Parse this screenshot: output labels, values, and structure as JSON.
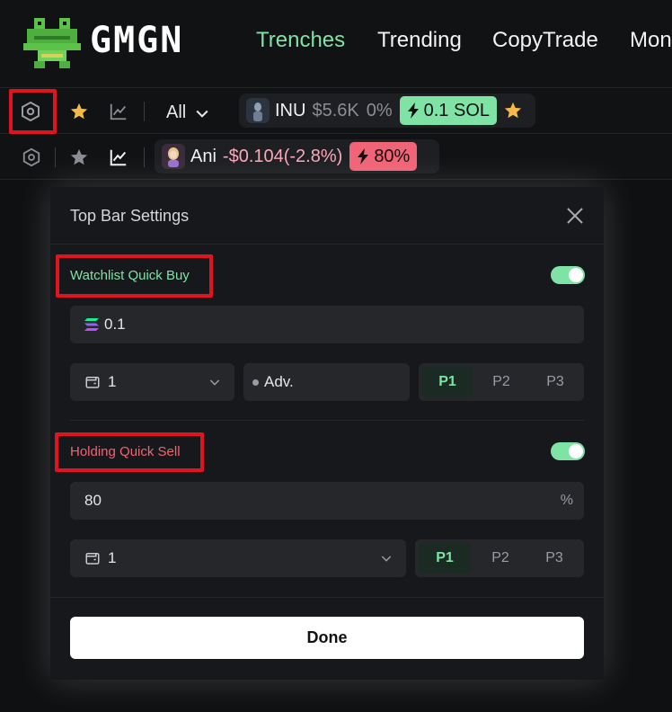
{
  "brand": {
    "name": "GMGN"
  },
  "nav": {
    "links": [
      "Trenches",
      "Trending",
      "CopyTrade",
      "Mon"
    ],
    "active": "Trenches"
  },
  "bar1": {
    "filter": "All",
    "token": {
      "symbol": "INU",
      "mcap": "$5.6K",
      "change": "0%",
      "quick_buy": "0.1 SOL"
    }
  },
  "bar2": {
    "token": {
      "symbol": "Ani",
      "pnl": "-$0.104(-2.8%)",
      "quick_sell": "80%"
    }
  },
  "modal": {
    "title": "Top Bar Settings",
    "buy": {
      "label": "Watchlist Quick Buy",
      "enabled": true,
      "amount": "0.1",
      "wallet": "1",
      "mode": "Adv.",
      "presets": [
        "P1",
        "P2",
        "P3"
      ],
      "active_preset": "P1"
    },
    "sell": {
      "label": "Holding Quick Sell",
      "enabled": true,
      "amount": "80",
      "unit": "%",
      "wallet": "1",
      "presets": [
        "P1",
        "P2",
        "P3"
      ],
      "active_preset": "P1"
    },
    "done_label": "Done"
  },
  "colors": {
    "accent_green": "#7fe3a6",
    "accent_red": "#f06477",
    "highlight": "#e0141e"
  }
}
